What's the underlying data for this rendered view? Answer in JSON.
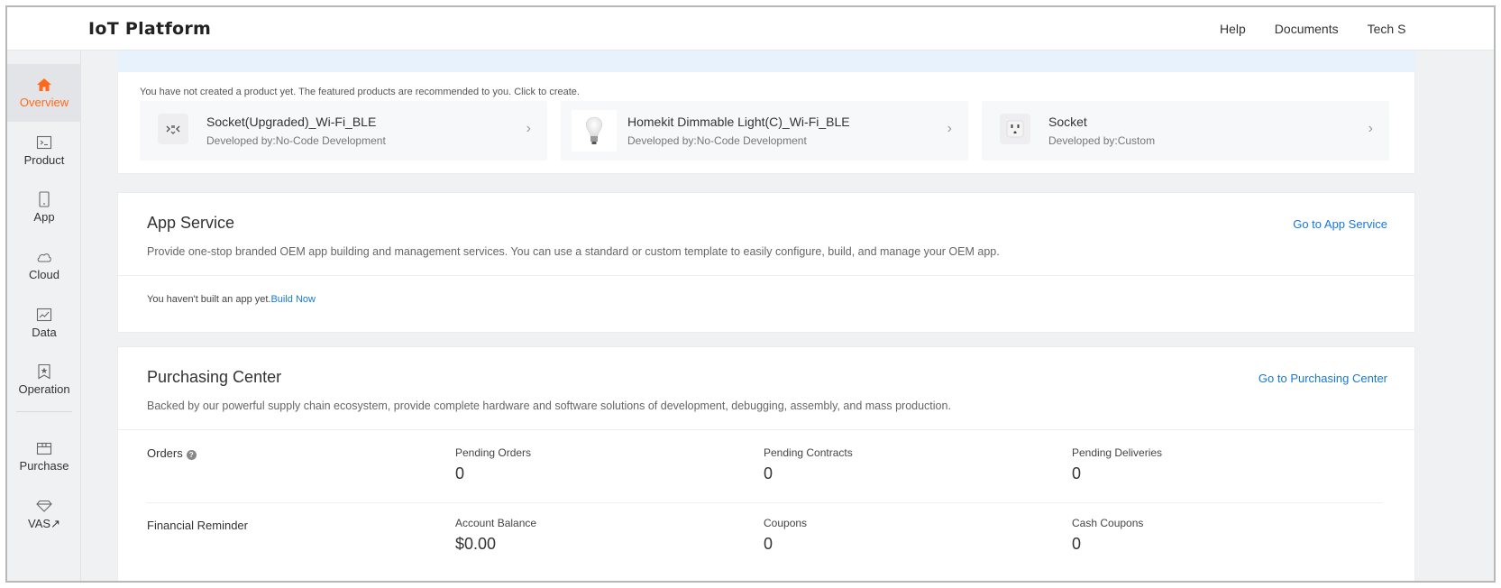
{
  "header": {
    "logo": "IoT Platform",
    "links": [
      "Help",
      "Documents",
      "Tech S"
    ]
  },
  "sidebar": {
    "items": [
      {
        "label": "Overview",
        "icon": "home-icon",
        "active": true
      },
      {
        "label": "Product",
        "icon": "terminal-icon"
      },
      {
        "label": "App",
        "icon": "phone-icon"
      },
      {
        "label": "Cloud",
        "icon": "cloud-icon"
      },
      {
        "label": "Data",
        "icon": "chart-icon"
      },
      {
        "label": "Operation",
        "icon": "bookmark-star-icon"
      },
      {
        "label": "Purchase",
        "icon": "box-icon"
      },
      {
        "label": "VAS↗",
        "icon": "diamond-icon"
      }
    ]
  },
  "featured": {
    "hint": "You have not created a product yet. The featured products are recommended to you. Click to create.",
    "products": [
      {
        "name": "Socket(Upgraded)_Wi-Fi_BLE",
        "developer": "Developed by:No-Code Development",
        "icon": "socket-icon"
      },
      {
        "name": "Homekit Dimmable Light(C)_Wi-Fi_BLE",
        "developer": "Developed by:No-Code Development",
        "icon": "bulb-icon"
      },
      {
        "name": "Socket",
        "developer": "Developed by:Custom",
        "icon": "outlet-icon"
      }
    ]
  },
  "app_service": {
    "title": "App Service",
    "link": "Go to App Service",
    "description": "Provide one-stop branded OEM app building and management services. You can use a standard or custom template to easily configure, build, and manage your OEM app.",
    "note": "You haven't built an app yet.",
    "note_link": "Build Now"
  },
  "purchasing": {
    "title": "Purchasing Center",
    "link": "Go to Purchasing Center",
    "description": "Backed by our powerful supply chain ecosystem, provide complete hardware and software solutions of development, debugging, assembly, and mass production.",
    "orders": {
      "label": "Orders",
      "metrics": [
        {
          "label": "Pending Orders",
          "value": "0"
        },
        {
          "label": "Pending Contracts",
          "value": "0"
        },
        {
          "label": "Pending Deliveries",
          "value": "0"
        }
      ]
    },
    "financial": {
      "label": "Financial Reminder",
      "metrics": [
        {
          "label": "Account Balance",
          "value": "$0.00"
        },
        {
          "label": "Coupons",
          "value": "0"
        },
        {
          "label": "Cash Coupons",
          "value": "0"
        }
      ]
    }
  },
  "colors": {
    "accent": "#ff6a1a",
    "link": "#1677d9",
    "banner": "#e8f2fd"
  }
}
